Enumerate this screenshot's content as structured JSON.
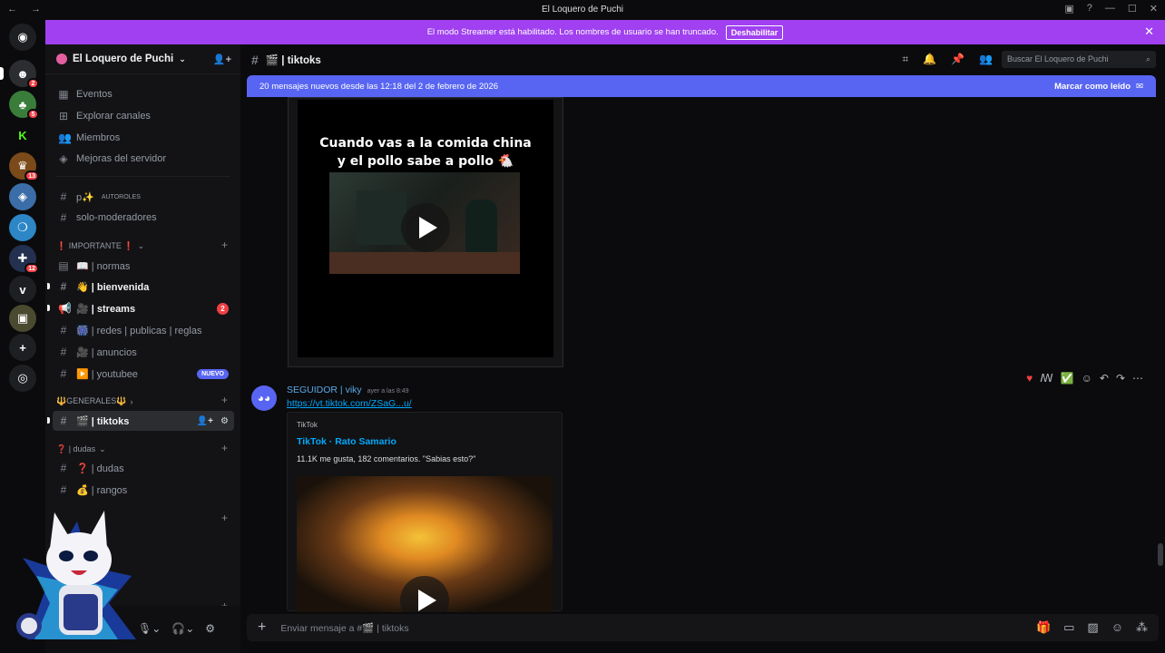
{
  "window": {
    "title": "El Loquero de Puchi"
  },
  "banner": {
    "message": "El modo Streamer está habilitado. Los nombres de usuario se han truncado.",
    "button": "Deshabilitar"
  },
  "servers": [
    {
      "name": "server-home",
      "glyph": "◉",
      "color": "#1e1f22"
    },
    {
      "name": "server-loquero",
      "glyph": "☻",
      "color": "#2b2d31",
      "badge": "2"
    },
    {
      "name": "server-green",
      "glyph": "♣",
      "color": "#3a7d3a",
      "badge": "5"
    },
    {
      "name": "server-kick",
      "glyph": "K",
      "color": "#0b0b0d"
    },
    {
      "name": "server-crown",
      "glyph": "♛",
      "color": "#7a4a1a",
      "badge": "13"
    },
    {
      "name": "server-blue",
      "glyph": "◈",
      "color": "#3b6ea8"
    },
    {
      "name": "server-bubble",
      "glyph": "❍",
      "color": "#2d86c6"
    },
    {
      "name": "server-flag",
      "glyph": "✚",
      "color": "#24304f",
      "badge": "12"
    },
    {
      "name": "server-v",
      "glyph": "v",
      "color": "#1e1f22"
    },
    {
      "name": "server-image",
      "glyph": "▣",
      "color": "#4a4a30"
    },
    {
      "name": "server-add",
      "glyph": "+",
      "color": "#1e1f22"
    },
    {
      "name": "server-discover",
      "glyph": "◎",
      "color": "#1e1f22"
    }
  ],
  "sidebar": {
    "guild_name": "El Loquero de Puchi",
    "top_items": [
      "Eventos",
      "Explorar canales",
      "Miembros",
      "Mejoras del servidor"
    ],
    "channel_autoroles": "p✨",
    "channel_autoroles_tag": "AUTOROLES",
    "channel_mods": "solo-moderadores",
    "cat_importante": "❗ IMPORTANTE ❗",
    "channels_importante": [
      {
        "name": "📖 | normas",
        "bold": false
      },
      {
        "name": "👋 | bienvenida",
        "bold": true
      },
      {
        "name": "🎥 | streams",
        "bold": true,
        "badge": "2"
      },
      {
        "name": "🎆 | redes | publicas | reglas",
        "bold": false
      },
      {
        "name": "🎥 | anuncios",
        "bold": false
      },
      {
        "name": "▶️ | youtubee",
        "bold": false,
        "tag": "NUEVO"
      }
    ],
    "cat_generales": "🔱GENERALES🔱",
    "channel_active": "🎬 | tiktoks",
    "cat_dudas": "❓ | dudas",
    "channels_dudas": [
      {
        "name": "❓ | dudas"
      },
      {
        "name": "💰 | rangos"
      }
    ]
  },
  "channel": {
    "name": "🎬 | tiktoks",
    "search_placeholder": "Buscar El Loquero de Puchi"
  },
  "new_messages_bar": {
    "text": "20 mensajes nuevos desde las 12:18 del 2 de febrero de 2026",
    "mark_read": "Marcar como leído"
  },
  "first_video": {
    "caption_line1": "Cuando vas a la comida china",
    "caption_line2": "y el pollo sabe a pollo 🐔"
  },
  "message": {
    "author": "SEGUIDOR | viky",
    "timestamp": "ayer a las 8:49",
    "link": "https://vt.tiktok.com/ZSaG...u/",
    "embed_provider": "TikTok",
    "embed_title": "TikTok · Rato Samario",
    "embed_description": "11.1K me gusta, 182 comentarios. \"Sabias esto?\""
  },
  "composer": {
    "placeholder": "Enviar mensaje a #🎬 | tiktoks"
  }
}
